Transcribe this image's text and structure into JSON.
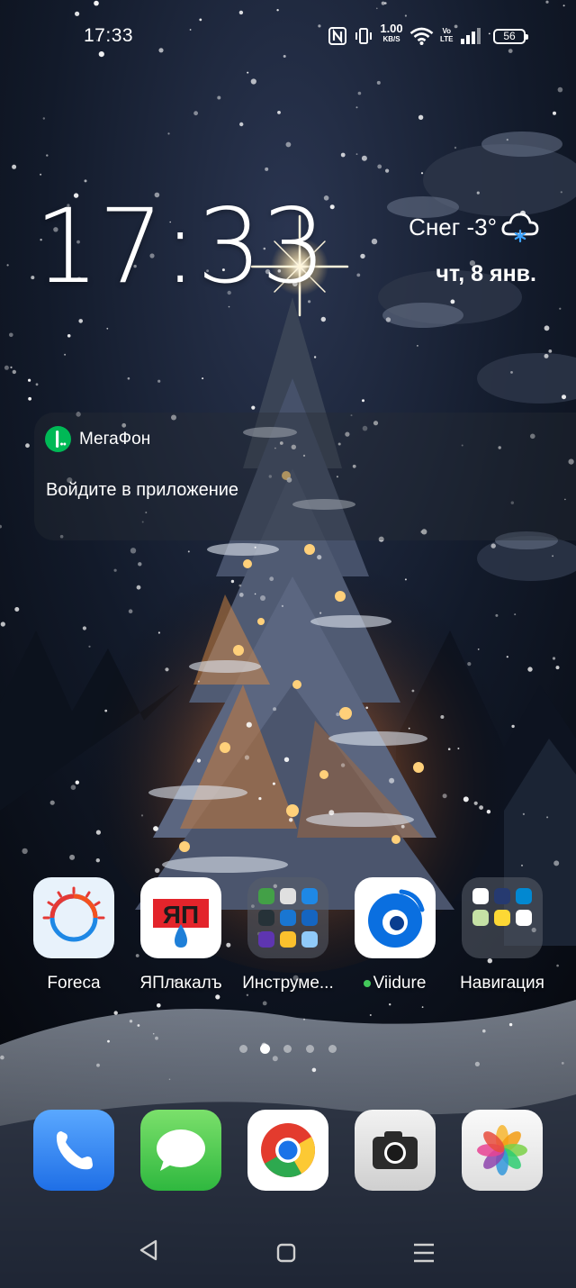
{
  "status_bar": {
    "time": "17:33",
    "net_speed": "1.00",
    "net_unit": "KB/S",
    "volte_top": "Vo",
    "volte_bottom": "LTE",
    "battery": "56",
    "icons": [
      "nfc-icon",
      "vibrate-icon",
      "net-speed",
      "wifi-icon",
      "volte-icon",
      "signal-icon",
      "battery-icon"
    ]
  },
  "clock_widget": {
    "time": "17:33",
    "weather": "Снег -3°",
    "weather_icon": "snow-cloud-icon",
    "date": "чт, 8 янв."
  },
  "notification": {
    "app": "МегаФон",
    "text": "Войдите в приложение",
    "accent": "#00b956"
  },
  "home_apps": [
    {
      "label": "Foreca",
      "icon": "foreca-icon"
    },
    {
      "label": "ЯПлакалъ",
      "icon": "yaplakal-icon",
      "logo_text": "ЯП"
    },
    {
      "label": "Инструме...",
      "icon": "tools-folder-icon"
    },
    {
      "label": "Viidure",
      "icon": "viidure-icon",
      "badge": "new-app-dot"
    },
    {
      "label": "Навигация",
      "icon": "navigation-folder-icon"
    }
  ],
  "page_indicator": {
    "pages": 5,
    "current": 2
  },
  "dock": [
    {
      "name": "phone",
      "icon": "phone-icon"
    },
    {
      "name": "messages",
      "icon": "message-icon"
    },
    {
      "name": "chrome",
      "icon": "chrome-icon"
    },
    {
      "name": "camera",
      "icon": "camera-icon"
    },
    {
      "name": "photos",
      "icon": "photos-icon"
    }
  ],
  "nav_bar": [
    "back-icon",
    "home-icon",
    "menu-icon"
  ]
}
